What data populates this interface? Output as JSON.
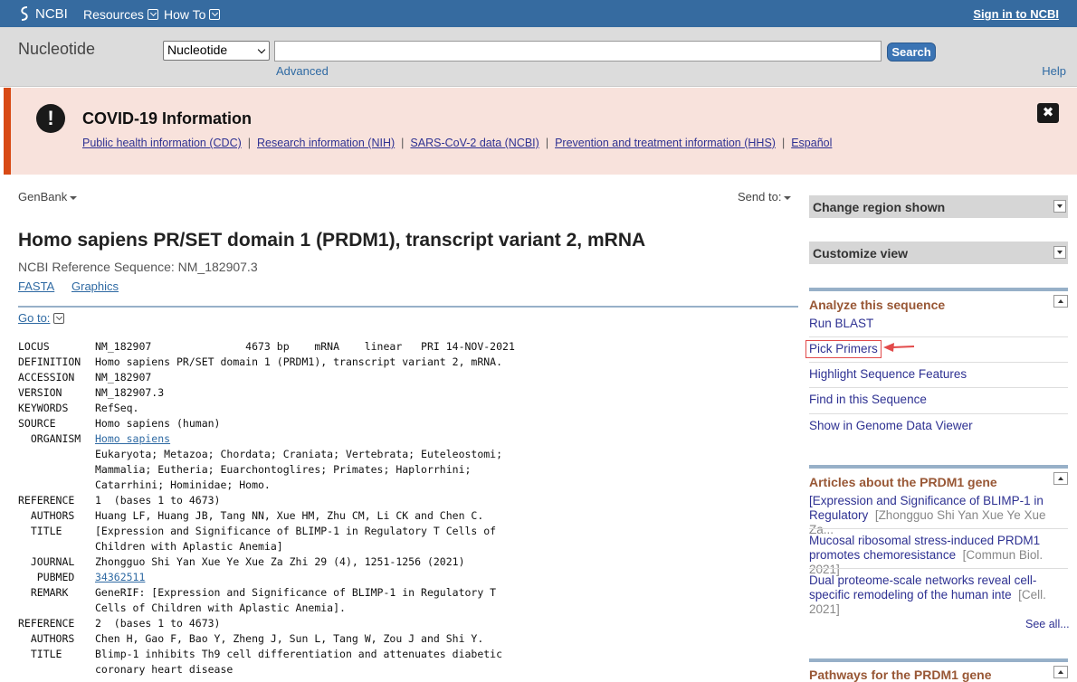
{
  "topbar": {
    "logo": "NCBI",
    "resources": "Resources",
    "howto": "How To",
    "signin": "Sign in to NCBI"
  },
  "search": {
    "db_title": "Nucleotide",
    "db_selected": "Nucleotide",
    "query": "",
    "button": "Search",
    "advanced": "Advanced",
    "help": "Help"
  },
  "covid": {
    "title": "COVID-19 Information",
    "links": [
      "Public health information (CDC)",
      "Research information (NIH)",
      "SARS-CoV-2 data (NCBI)",
      "Prevention and treatment information (HHS)",
      "Español"
    ],
    "sep": "|",
    "close": "✖"
  },
  "record": {
    "format": "GenBank",
    "sendto": "Send to:",
    "title": "Homo sapiens PR/SET domain 1 (PRDM1), transcript variant 2, mRNA",
    "refseq": "NCBI Reference Sequence: NM_182907.3",
    "fasta": "FASTA",
    "graphics": "Graphics",
    "goto": "Go to:"
  },
  "genbank": [
    {
      "key": "LOCUS",
      "val": "NM_182907               4673 bp    mRNA    linear   PRI 14-NOV-2021"
    },
    {
      "key": "DEFINITION",
      "val": "Homo sapiens PR/SET domain 1 (PRDM1), transcript variant 2, mRNA."
    },
    {
      "key": "ACCESSION",
      "val": "NM_182907"
    },
    {
      "key": "VERSION",
      "val": "NM_182907.3"
    },
    {
      "key": "KEYWORDS",
      "val": "RefSeq."
    },
    {
      "key": "SOURCE",
      "val": "Homo sapiens (human)"
    },
    {
      "key": "  ORGANISM",
      "val": "Homo sapiens",
      "link": true
    },
    {
      "key": "",
      "val": "Eukaryota; Metazoa; Chordata; Craniata; Vertebrata; Euteleostomi;"
    },
    {
      "key": "",
      "val": "Mammalia; Eutheria; Euarchontoglires; Primates; Haplorrhini;"
    },
    {
      "key": "",
      "val": "Catarrhini; Hominidae; Homo."
    },
    {
      "key": "REFERENCE",
      "val": "1  (bases 1 to 4673)"
    },
    {
      "key": "  AUTHORS",
      "val": "Huang LF, Huang JB, Tang NN, Xue HM, Zhu CM, Li CK and Chen C."
    },
    {
      "key": "  TITLE",
      "val": "[Expression and Significance of BLIMP-1 in Regulatory T Cells of"
    },
    {
      "key": "",
      "val": "Children with Aplastic Anemia]"
    },
    {
      "key": "  JOURNAL",
      "val": "Zhongguo Shi Yan Xue Ye Xue Za Zhi 29 (4), 1251-1256 (2021)"
    },
    {
      "key": "   PUBMED",
      "val": "34362511",
      "link": true
    },
    {
      "key": "  REMARK",
      "val": "GeneRIF: [Expression and Significance of BLIMP-1 in Regulatory T"
    },
    {
      "key": "",
      "val": "Cells of Children with Aplastic Anemia]."
    },
    {
      "key": "REFERENCE",
      "val": "2  (bases 1 to 4673)"
    },
    {
      "key": "  AUTHORS",
      "val": "Chen H, Gao F, Bao Y, Zheng J, Sun L, Tang W, Zou J and Shi Y."
    },
    {
      "key": "  TITLE",
      "val": "Blimp-1 inhibits Th9 cell differentiation and attenuates diabetic"
    },
    {
      "key": "",
      "val": "coronary heart disease"
    }
  ],
  "sidebar": {
    "change_region": "Change region shown",
    "customize": "Customize view",
    "analyze_title": "Analyze this sequence",
    "analyze_links": [
      "Run BLAST",
      "Pick Primers",
      "Highlight Sequence Features",
      "Find in this Sequence",
      "Show in Genome Data Viewer"
    ],
    "articles_title": "Articles about the PRDM1 gene",
    "articles": [
      {
        "line1": "[Expression and Significance of BLIMP-1 in",
        "line2": "Regulatory",
        "src": "[Zhongguo Shi Yan Xue Ye Xue Za..."
      },
      {
        "line1": "Mucosal ribosomal stress-induced PRDM1",
        "line2": "promotes chemoresistance",
        "src": "[Commun Biol. 2021]"
      },
      {
        "line1": "Dual proteome-scale networks reveal cell-",
        "line2": "specific remodeling of the human inte",
        "src": "[Cell. 2021]"
      }
    ],
    "see_all": "See all...",
    "pathways_title": "Pathways for the PRDM1 gene"
  },
  "colors": {
    "ncbi_blue": "#366ba0",
    "covid_bg": "#f8e2dc",
    "covid_accent": "#d84a15",
    "section_title": "#985735",
    "highlight": "#e24a4a"
  }
}
